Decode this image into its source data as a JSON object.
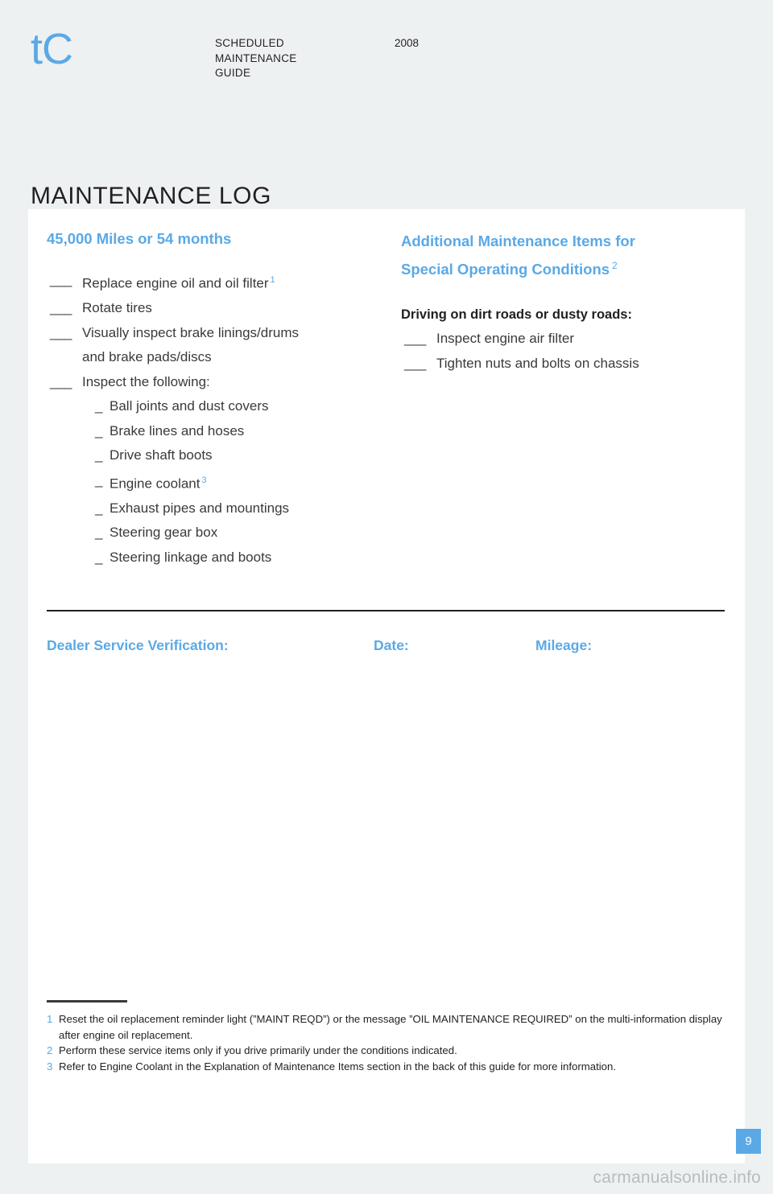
{
  "masthead": {
    "brand": "tC",
    "guide_title": "SCHEDULED\nMAINTENANCE\nGUIDE",
    "guide_title_line1": "SCHEDULED",
    "guide_title_line2": "MAINTENANCE",
    "guide_title_line3": "GUIDE",
    "model_year": "2008"
  },
  "page_title": "MAINTENANCE LOG",
  "left_column": {
    "interval_heading": "45,000 Miles or 54 months",
    "blank_mark": "___",
    "dash_mark": "_",
    "tasks": [
      {
        "text": "Replace engine oil and oil filter",
        "footnote": "1",
        "has_blank": true
      },
      {
        "text": "Rotate tires",
        "footnote": "",
        "has_blank": true
      },
      {
        "text": "Visually inspect brake linings/drums",
        "footnote": "",
        "has_blank": true
      },
      {
        "text": "and brake pads/discs",
        "footnote": "",
        "has_blank": false
      },
      {
        "text": "Inspect the following:",
        "footnote": "",
        "has_blank": true
      }
    ],
    "sub_tasks": [
      {
        "text": "Ball joints and dust covers",
        "footnote": ""
      },
      {
        "text": "Brake lines and hoses",
        "footnote": ""
      },
      {
        "text": "Drive shaft boots",
        "footnote": ""
      },
      {
        "text": "Engine coolant",
        "footnote": "3"
      },
      {
        "text": "Exhaust pipes and mountings",
        "footnote": ""
      },
      {
        "text": "Steering gear box",
        "footnote": ""
      },
      {
        "text": "Steering linkage and boots",
        "footnote": ""
      }
    ]
  },
  "right_column": {
    "section_heading_line1": "Additional Maintenance Items for",
    "section_heading_line2": "Special Operating Conditions",
    "section_heading_footnote": "2",
    "condition_heading": "Driving on dirt roads or dusty roads:",
    "blank_mark": "___",
    "tasks": [
      {
        "text": "Inspect engine air filter"
      },
      {
        "text": "Tighten nuts and bolts on chassis"
      }
    ]
  },
  "verification": {
    "dealer_label": "Dealer Service Verification:",
    "date_label": "Date:",
    "mileage_label": "Mileage:"
  },
  "footnotes": [
    {
      "num": "1",
      "text": "Reset the oil replacement reminder light (”MAINT REQD”) or the message ”OIL MAINTENANCE REQUIRED” on the multi-information display after engine oil replacement."
    },
    {
      "num": "2",
      "text": "Perform these service items only if you drive primarily under the conditions indicated."
    },
    {
      "num": "3",
      "text": "Refer to Engine Coolant in the Explanation of Maintenance Items section in the back of this guide for more information."
    }
  ],
  "page_number": "9",
  "watermark": "carmanualsonline.info",
  "colors": {
    "accent_blue": "#5aa9e6",
    "page_background": "#eef1f2",
    "sheet_background": "#ffffff",
    "body_text": "#231f20",
    "watermark_gray": "#b9bcbe"
  }
}
